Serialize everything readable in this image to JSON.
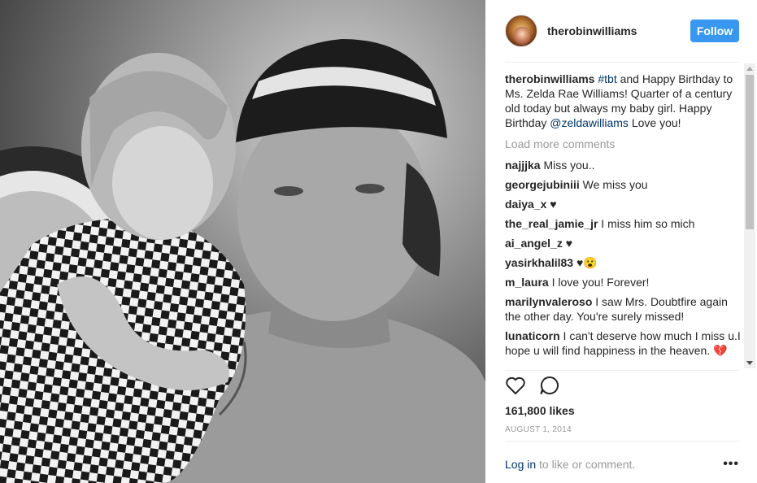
{
  "post": {
    "username": "therobinwilliams",
    "follow_label": "Follow",
    "caption_username": "therobinwilliams",
    "caption_hashtag": "#tbt",
    "caption_text_1": " and Happy Birthday to Ms. Zelda Rae Williams! Quarter of a century old today but always my baby girl. Happy Birthday ",
    "caption_mention": "@zeldawilliams",
    "caption_text_2": " Love you!",
    "load_more": "Load more comments",
    "comments": [
      {
        "user": "najjjka",
        "text": " Miss you.."
      },
      {
        "user": "georgejubiniii",
        "text": " We miss you"
      },
      {
        "user": "daiya_x",
        "text": " ♥"
      },
      {
        "user": "the_real_jamie_jr",
        "text": " I miss him so mich"
      },
      {
        "user": "ai_angel_z",
        "text": " ♥"
      },
      {
        "user": "yasirkhalil83",
        "text": " ♥😮"
      },
      {
        "user": "m_laura",
        "text": " I love you! Forever!"
      },
      {
        "user": "marilynvaleroso",
        "text": " I saw Mrs. Doubtfire again the other day. You're surely missed!"
      },
      {
        "user": "lunaticorn",
        "text": " I can't deserve how much I miss u.I hope u will find happiness in the heaven. 💔"
      }
    ],
    "likes": "161,800 likes",
    "date": "AUGUST 1, 2014",
    "login_link": "Log in",
    "login_rest": " to like or comment.",
    "more_label": "•••"
  },
  "icons": {
    "like": "heart-outline-icon",
    "comment": "speech-bubble-icon",
    "more": "more-options-icon"
  },
  "colors": {
    "follow_bg": "#3897f0",
    "link": "#003569",
    "muted": "#999999"
  }
}
